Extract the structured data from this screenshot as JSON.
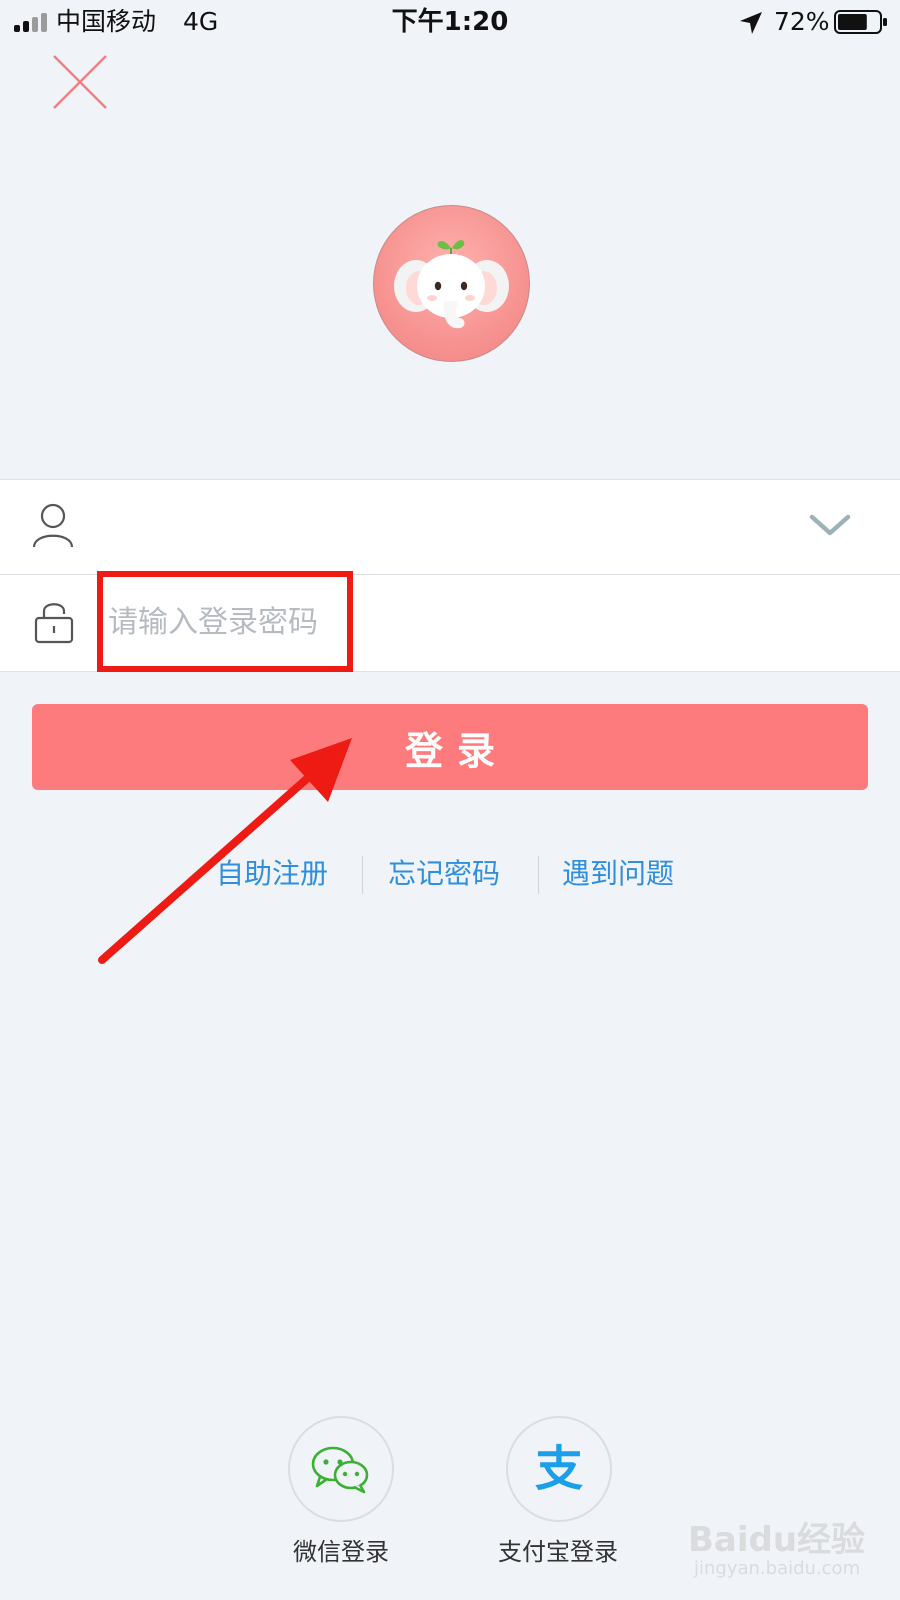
{
  "status_bar": {
    "carrier": "中国移动",
    "network": "4G",
    "time": "下午1:20",
    "battery_percent": "72%",
    "battery_level": 0.72
  },
  "close_button": {
    "icon": "close-icon"
  },
  "avatar": {
    "icon": "elephant-mascot"
  },
  "form": {
    "username_icon": "user-icon",
    "username_value": "",
    "dropdown_icon": "chevron-down-icon",
    "password_icon": "lock-icon",
    "password_placeholder": "请输入登录密码"
  },
  "login_button": {
    "label": "登录"
  },
  "links": {
    "register": "自助注册",
    "forgot": "忘记密码",
    "problem": "遇到问题"
  },
  "social": {
    "wechat_label": "微信登录",
    "alipay_label": "支付宝登录",
    "alipay_glyph": "支"
  },
  "watermark": {
    "logo_text": "Baidu经验",
    "url": "jingyan.baidu.com"
  },
  "colors": {
    "background": "#f0f3f7",
    "primary_button": "#fe7b7d",
    "link": "#2f8fdc",
    "annotation_red": "#ee1b14",
    "wechat_green": "#3cb034",
    "alipay_blue": "#1a9fe8"
  }
}
